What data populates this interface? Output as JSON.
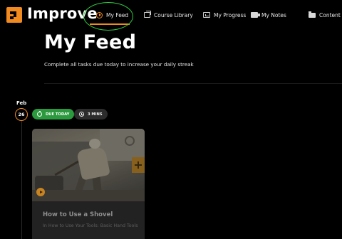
{
  "app": {
    "name": "Improve"
  },
  "nav": {
    "items": [
      {
        "label": "My Feed",
        "active": true
      },
      {
        "label": "Course Library"
      },
      {
        "label": "My Progress"
      },
      {
        "label": "My Notes"
      },
      {
        "label": "Content M"
      }
    ]
  },
  "header": {
    "title": "My Feed",
    "subtitle": "Complete all tasks due today to increase your daily streak"
  },
  "feed": {
    "date": {
      "month": "Feb",
      "day": "26"
    },
    "badges": {
      "due": "DUE TODAY",
      "duration": "3 MINS"
    },
    "card": {
      "title": "How to Use a Shovel",
      "subtitle": "In How to Use Your Tools: Basic Hand Tools"
    }
  },
  "colors": {
    "accent": "#f18a1f",
    "due_badge": "#2b9a3e",
    "highlight_ring": "#2ecc40",
    "background": "#000000"
  },
  "icons": {
    "logo": "improve-logo",
    "feed": "play-circle-icon",
    "library": "library-icon",
    "progress": "progress-icon",
    "notes": "notes-icon",
    "content": "folder-icon"
  }
}
